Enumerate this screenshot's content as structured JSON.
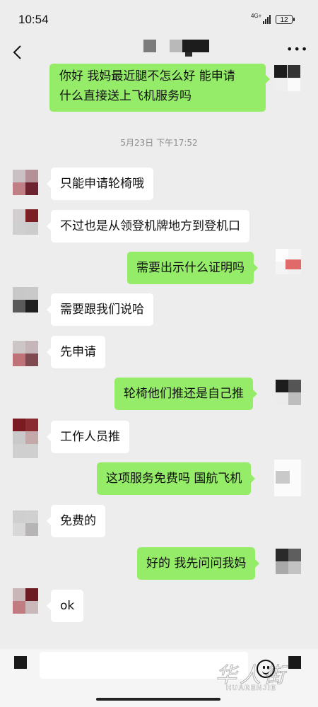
{
  "status_bar": {
    "time": "10:54",
    "network": "4G+",
    "battery": "12"
  },
  "chat_header": {
    "back_icon": "chevron-left-icon",
    "more_icon": "more-dots-icon"
  },
  "messages": [
    {
      "side": "out",
      "text": "你好  我妈最近腿不怎么好 能申请\n什么直接送上飞机服务吗"
    },
    {
      "type": "timestamp",
      "text": "5月23日 下午17:52"
    },
    {
      "side": "in",
      "text": "只能申请轮椅哦"
    },
    {
      "side": "in",
      "text": "不过也是从领登机牌地方到登机口"
    },
    {
      "side": "out",
      "text": "需要出示什么证明吗"
    },
    {
      "side": "in",
      "text": "需要跟我们说哈"
    },
    {
      "side": "in",
      "text": "先申请"
    },
    {
      "side": "out",
      "text": "轮椅他们推还是自己推"
    },
    {
      "side": "in",
      "text": "工作人员推"
    },
    {
      "side": "out",
      "text": "这项服务免费吗 国航飞机"
    },
    {
      "side": "in",
      "text": "免费的"
    },
    {
      "side": "out",
      "text": "好的 我先问问我妈"
    },
    {
      "side": "in",
      "text": "ok"
    }
  ],
  "input_bar": {
    "voice_icon": "voice-icon",
    "emoji_icon": "emoji-icon",
    "plus_icon": "plus-icon"
  },
  "watermark": {
    "cn": "华人街",
    "en": "HUARENJIE"
  },
  "colors": {
    "background": "#ededed",
    "incoming_bubble": "#ffffff",
    "outgoing_bubble": "#95ec69"
  }
}
